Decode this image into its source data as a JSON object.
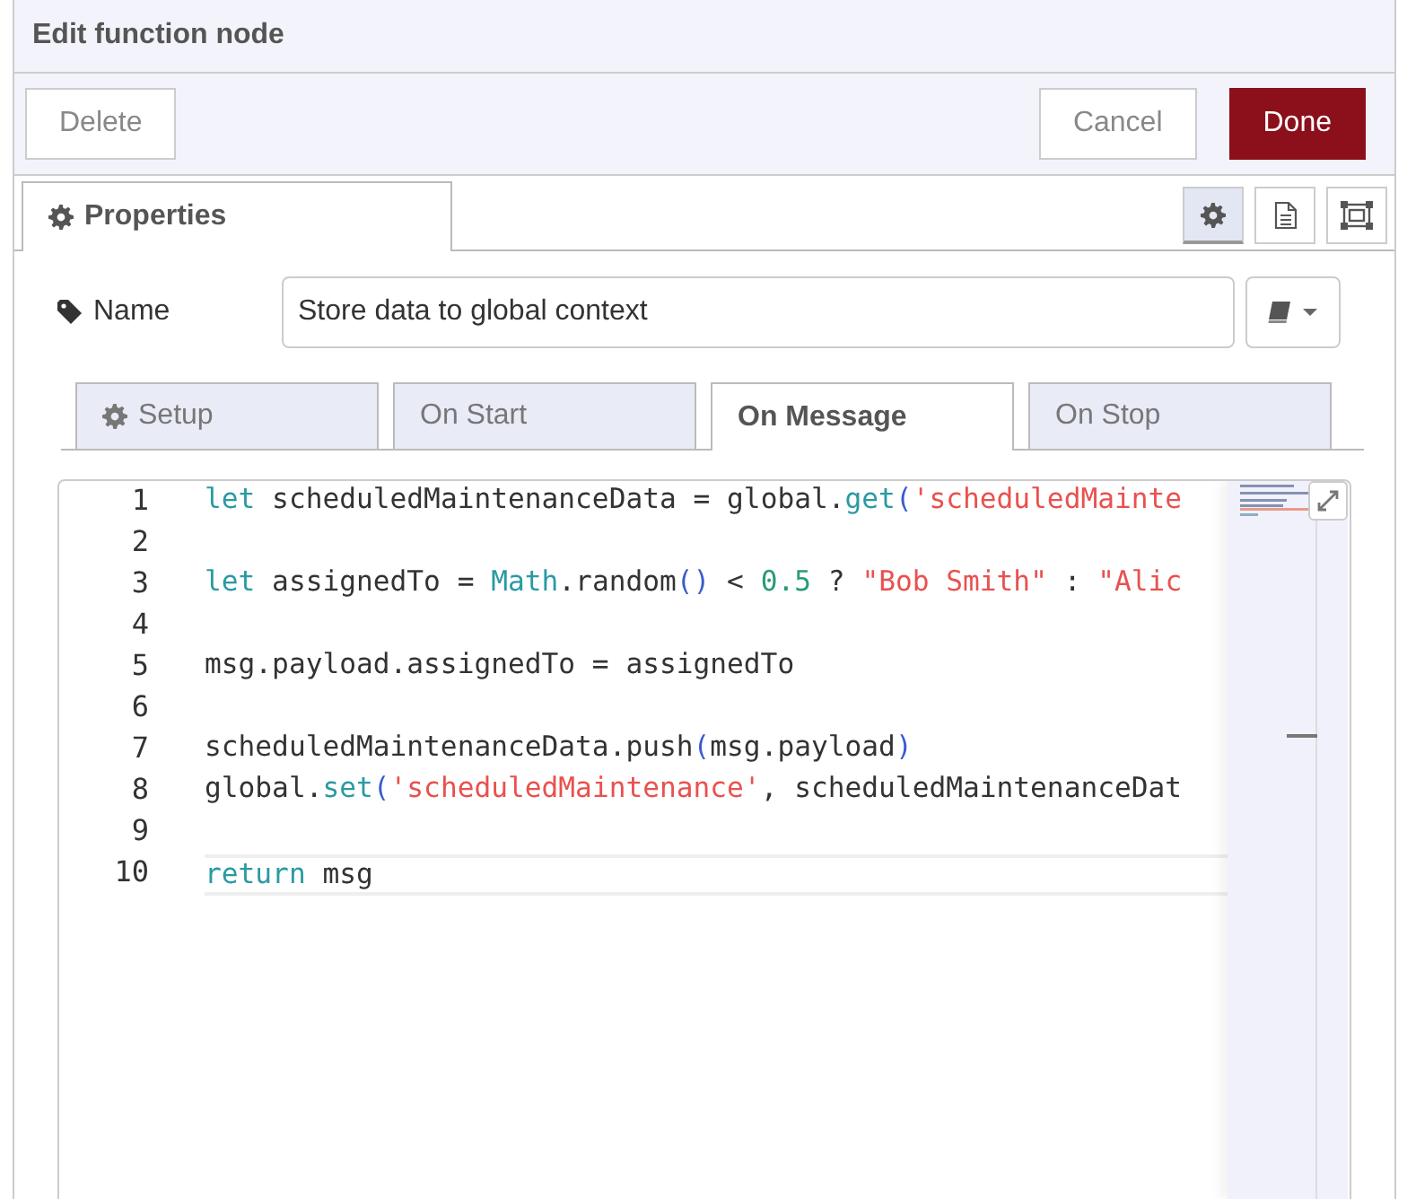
{
  "dialog": {
    "title": "Edit function node"
  },
  "buttons": {
    "delete": "Delete",
    "cancel": "Cancel",
    "done": "Done"
  },
  "tabs": [
    {
      "label": "Properties",
      "selected": true
    }
  ],
  "tab_tools": [
    {
      "kind": "gear",
      "selected": true
    },
    {
      "kind": "doc",
      "selected": false
    },
    {
      "kind": "frame",
      "selected": false
    }
  ],
  "name_field": {
    "label": "Name",
    "value": "Store data to global context"
  },
  "sub_tabs": [
    {
      "label": "Setup",
      "icon": true,
      "selected": false
    },
    {
      "label": "On Start",
      "icon": false,
      "selected": false
    },
    {
      "label": "On Message",
      "icon": false,
      "selected": true
    },
    {
      "label": "On Stop",
      "icon": false,
      "selected": false
    }
  ],
  "editor": {
    "lines": [
      {
        "number": "1",
        "current": false,
        "tokens": [
          {
            "kind": "keyword",
            "text": "let"
          },
          {
            "kind": "plain",
            "text": " scheduledMaintenanceData = global."
          },
          {
            "kind": "function",
            "text": "get"
          },
          {
            "kind": "paren",
            "text": "("
          },
          {
            "kind": "string",
            "text": "'scheduledMainte"
          }
        ]
      },
      {
        "number": "2",
        "current": false
      },
      {
        "number": "3",
        "current": false,
        "tokens": [
          {
            "kind": "keyword",
            "text": "let"
          },
          {
            "kind": "plain",
            "text": " assignedTo = "
          },
          {
            "kind": "function",
            "text": "Math"
          },
          {
            "kind": "plain",
            "text": ".random"
          },
          {
            "kind": "paren",
            "text": "()"
          },
          {
            "kind": "plain",
            "text": " < "
          },
          {
            "kind": "number",
            "text": "0.5"
          },
          {
            "kind": "plain",
            "text": " ? "
          },
          {
            "kind": "string",
            "text": "\"Bob Smith\""
          },
          {
            "kind": "plain",
            "text": " : "
          },
          {
            "kind": "string",
            "text": "\"Alic"
          }
        ]
      },
      {
        "number": "4",
        "current": false
      },
      {
        "number": "5",
        "current": false,
        "tokens": [
          {
            "kind": "plain",
            "text": "msg.payload.assignedTo = assignedTo"
          }
        ]
      },
      {
        "number": "6",
        "current": false
      },
      {
        "number": "7",
        "current": false,
        "tokens": [
          {
            "kind": "plain",
            "text": "scheduledMaintenanceData.push"
          },
          {
            "kind": "paren",
            "text": "("
          },
          {
            "kind": "plain",
            "text": "msg.payload"
          },
          {
            "kind": "paren",
            "text": ")"
          }
        ]
      },
      {
        "number": "8",
        "current": false,
        "tokens": [
          {
            "kind": "plain",
            "text": "global."
          },
          {
            "kind": "function",
            "text": "set"
          },
          {
            "kind": "paren",
            "text": "("
          },
          {
            "kind": "string",
            "text": "'scheduledMaintenance'"
          },
          {
            "kind": "plain",
            "text": ", scheduledMaintenanceDat"
          }
        ]
      },
      {
        "number": "9",
        "current": false
      },
      {
        "number": "10",
        "current": true,
        "tokens": [
          {
            "kind": "keyword",
            "text": "return"
          },
          {
            "kind": "plain",
            "text": " msg"
          }
        ]
      }
    ]
  }
}
